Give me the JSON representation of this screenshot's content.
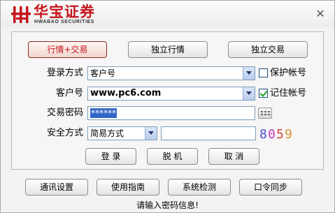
{
  "brand": {
    "name_cn": "华宝证券",
    "name_en": "HWABAO SECURITIES",
    "brand_color": "#c5161d"
  },
  "window": {
    "close_icon": "close-icon"
  },
  "mode_tabs": [
    {
      "label": "行情+交易",
      "active": true
    },
    {
      "label": "独立行情",
      "active": false
    },
    {
      "label": "独立交易",
      "active": false
    }
  ],
  "form": {
    "login_method_label": "登录方式",
    "login_method_value": "客户号",
    "protect_account_label": "保护帐号",
    "protect_account_checked": false,
    "client_id_label": "客户号",
    "client_id_value": "www.pc6.com",
    "remember_account_label": "记住帐号",
    "remember_account_checked": true,
    "password_label": "交易密码",
    "password_value": "******",
    "security_label": "安全方式",
    "security_value": "简易方式",
    "security_input_value": "",
    "captcha_text": "8059"
  },
  "actions": {
    "login": "登 录",
    "offline": "脱 机",
    "cancel": "取 消"
  },
  "bottom_buttons": [
    "通讯设置",
    "使用指南",
    "系统检测",
    "口令同步"
  ],
  "status_text": "请输入密码信息!"
}
